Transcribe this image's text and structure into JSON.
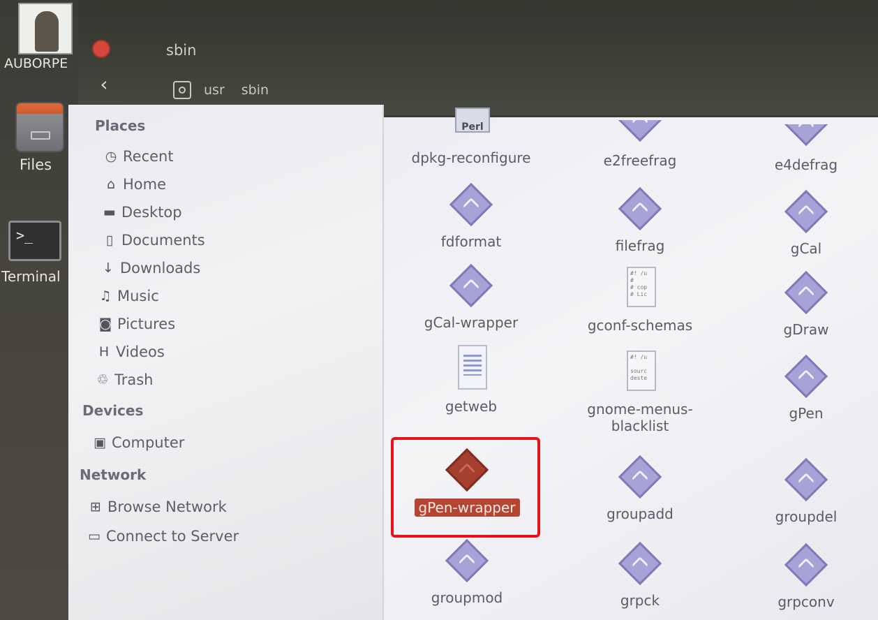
{
  "window": {
    "title": "sbin"
  },
  "path": [
    "usr",
    "sbin"
  ],
  "launcher": {
    "user_label": "AUBORPE",
    "files_label": "Files",
    "terminal_label": "Terminal",
    "terminal_prompt": ">_"
  },
  "sidebar": {
    "places_heading": "Places",
    "places": [
      {
        "label": "Recent",
        "icon": "clock-icon"
      },
      {
        "label": "Home",
        "icon": "home-icon"
      },
      {
        "label": "Desktop",
        "icon": "folder-icon"
      },
      {
        "label": "Documents",
        "icon": "document-icon"
      },
      {
        "label": "Downloads",
        "icon": "download-icon"
      },
      {
        "label": "Music",
        "icon": "music-icon"
      },
      {
        "label": "Pictures",
        "icon": "camera-icon"
      },
      {
        "label": "Videos",
        "icon": "film-icon"
      },
      {
        "label": "Trash",
        "icon": "trash-icon"
      }
    ],
    "devices_heading": "Devices",
    "devices": [
      {
        "label": "Computer",
        "icon": "drive-icon"
      }
    ],
    "network_heading": "Network",
    "network": [
      {
        "label": "Browse Network",
        "icon": "network-icon"
      },
      {
        "label": "Connect to Server",
        "icon": "server-icon"
      }
    ]
  },
  "files": [
    {
      "name": "dpkg-reconfigure",
      "icon": "perl-script-icon",
      "badge": "Perl"
    },
    {
      "name": "e2freefrag",
      "icon": "executable-icon"
    },
    {
      "name": "e4defrag",
      "icon": "executable-icon"
    },
    {
      "name": "fdformat",
      "icon": "executable-icon"
    },
    {
      "name": "filefrag",
      "icon": "executable-icon"
    },
    {
      "name": "gCal",
      "icon": "executable-icon"
    },
    {
      "name": "gCal-wrapper",
      "icon": "executable-icon"
    },
    {
      "name": "gconf-schemas",
      "icon": "script-icon"
    },
    {
      "name": "gDraw",
      "icon": "executable-icon"
    },
    {
      "name": "getweb",
      "icon": "text-document-icon"
    },
    {
      "name": "gnome-menus-blacklist",
      "icon": "script-icon"
    },
    {
      "name": "gPen",
      "icon": "executable-icon"
    },
    {
      "name": "gPen-wrapper",
      "icon": "executable-icon",
      "selected": true
    },
    {
      "name": "groupadd",
      "icon": "executable-icon"
    },
    {
      "name": "groupdel",
      "icon": "executable-icon"
    },
    {
      "name": "groupmod",
      "icon": "executable-icon"
    },
    {
      "name": "grpck",
      "icon": "executable-icon"
    },
    {
      "name": "grpconv",
      "icon": "executable-icon"
    }
  ],
  "colors": {
    "selection": "#b54432",
    "highlight_box": "#e8121a",
    "close_button": "#d8473b"
  }
}
